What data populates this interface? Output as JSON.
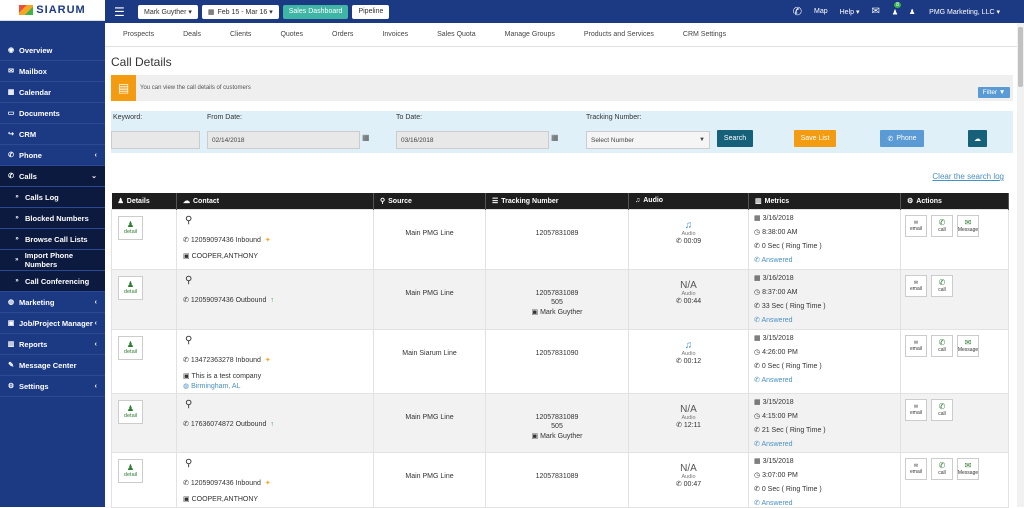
{
  "logo": {
    "text": "SIARUM"
  },
  "sidebar": {
    "items": [
      {
        "label": "Overview",
        "icon": "dashboard-icon",
        "glyph": "◉",
        "chev": ""
      },
      {
        "label": "Mailbox",
        "icon": "envelope-icon",
        "glyph": "✉",
        "chev": ""
      },
      {
        "label": "Calendar",
        "icon": "calendar-icon",
        "glyph": "▦",
        "chev": ""
      },
      {
        "label": "Documents",
        "icon": "folder-icon",
        "glyph": "▭",
        "chev": ""
      },
      {
        "label": "CRM",
        "icon": "share-icon",
        "glyph": "↪",
        "chev": ""
      },
      {
        "label": "Phone",
        "icon": "phone-icon",
        "glyph": "✆",
        "chev": "‹"
      },
      {
        "label": "Calls",
        "icon": "phone-icon",
        "glyph": "✆",
        "chev": "⌄"
      },
      {
        "label": "Calls Log",
        "icon": "chevron-right-icon",
        "glyph": "»",
        "chev": ""
      },
      {
        "label": "Blocked Numbers",
        "icon": "chevron-right-icon",
        "glyph": "»",
        "chev": ""
      },
      {
        "label": "Browse Call Lists",
        "icon": "chevron-right-icon",
        "glyph": "»",
        "chev": ""
      },
      {
        "label": "Import Phone Numbers",
        "icon": "chevron-right-icon",
        "glyph": "»",
        "chev": ""
      },
      {
        "label": "Call Conferencing",
        "icon": "chevron-right-icon",
        "glyph": "»",
        "chev": ""
      },
      {
        "label": "Marketing",
        "icon": "globe-icon",
        "glyph": "◍",
        "chev": "‹"
      },
      {
        "label": "Job/Project Manager",
        "icon": "briefcase-icon",
        "glyph": "▣",
        "chev": "‹"
      },
      {
        "label": "Reports",
        "icon": "chart-icon",
        "glyph": "▥",
        "chev": "‹"
      },
      {
        "label": "Message Center",
        "icon": "edit-icon",
        "glyph": "✎",
        "chev": ""
      },
      {
        "label": "Settings",
        "icon": "gear-icon",
        "glyph": "⚙",
        "chev": "‹"
      }
    ]
  },
  "topbar": {
    "user_select": "Mark Guyther ▾",
    "date_range": "Feb 15 - Mar 16 ▾",
    "sales_dashboard": "Sales Dashboard",
    "pipeline": "Pipeline",
    "map": "Map",
    "help": "Help ▾",
    "notif_count": "8",
    "company": "PMG Marketing, LLC ▾"
  },
  "menu": [
    "Prospects",
    "Deals",
    "Clients",
    "Quotes",
    "Orders",
    "Invoices",
    "Sales Quota",
    "Manage Groups",
    "Products and Services",
    "CRM Settings"
  ],
  "page": {
    "title": "Call Details",
    "info": "You can view the call details of customers",
    "filter_btn": "Filter ▼",
    "clear": "Clear the search log"
  },
  "filters": {
    "keyword_label": "Keyword:",
    "keyword_value": "",
    "from_label": "From Date:",
    "from_value": "02/14/2018",
    "to_label": "To Date:",
    "to_value": "03/16/2018",
    "tracking_label": "Tracking Number:",
    "tracking_value": "Select Number",
    "search": "Search",
    "save_list": "Save List",
    "phone": "Phone",
    "cloud_glyph": "☁"
  },
  "colors": {
    "sidebar": "#1c3a84",
    "teal": "#3fb5a6",
    "orange": "#f39c12",
    "blue": "#5b9bd5",
    "dark_teal": "#16607a"
  },
  "table": {
    "headers": [
      "Details",
      "Contact",
      "Source",
      "Tracking Number",
      "Audio",
      "Metrics",
      "Actions"
    ],
    "header_icons": [
      "person-icon",
      "cloud-icon",
      "search-icon",
      "list-icon",
      "headphones-icon",
      "chart-icon",
      "gear-icon"
    ],
    "header_glyphs": [
      "♟",
      "☁",
      "⚲",
      "☰",
      "♫",
      "▥",
      "⚙"
    ],
    "detail_label": "detail",
    "audio_label": "Audio",
    "rows": [
      {
        "phone": "12059097436",
        "dir": "Inbound",
        "line2": "COOPER,ANTHONY",
        "line3": "",
        "source": "Main PMG Line",
        "tracking": "12057831089",
        "ext": "",
        "agent": "",
        "audio": "play",
        "na": "",
        "duration": "00:09",
        "date": "3/16/2018",
        "time": "8:38:00 AM",
        "ring": "0 Sec ( Ring Time )",
        "status": "Answered",
        "actions": [
          "email",
          "call",
          "Message"
        ]
      },
      {
        "phone": "12059097436",
        "dir": "Outbound",
        "line2": "",
        "line3": "",
        "source": "Main PMG Line",
        "tracking": "12057831089",
        "ext": "505",
        "agent": "Mark Guyther",
        "audio": "na",
        "na": "N/A",
        "duration": "00:44",
        "date": "3/16/2018",
        "time": "8:37:00 AM",
        "ring": "33 Sec ( Ring Time )",
        "status": "Answered",
        "actions": [
          "email",
          "call"
        ]
      },
      {
        "phone": "13472363278",
        "dir": "Inbound",
        "line2": "This is a test company",
        "line3": "Birmingham, AL",
        "source": "Main Siarum Line",
        "tracking": "12057831090",
        "ext": "",
        "agent": "",
        "audio": "play",
        "na": "",
        "duration": "00:12",
        "date": "3/15/2018",
        "time": "4:26:00 PM",
        "ring": "0 Sec ( Ring Time )",
        "status": "Answered",
        "actions": [
          "email",
          "call",
          "Message"
        ]
      },
      {
        "phone": "17636074872",
        "dir": "Outbound",
        "line2": "",
        "line3": "",
        "source": "Main PMG Line",
        "tracking": "12057831089",
        "ext": "505",
        "agent": "Mark Guyther",
        "audio": "na",
        "na": "N/A",
        "duration": "12:11",
        "date": "3/15/2018",
        "time": "4:15:00 PM",
        "ring": "21 Sec ( Ring Time )",
        "status": "Answered",
        "actions": [
          "email",
          "call"
        ]
      },
      {
        "phone": "12059097436",
        "dir": "Inbound",
        "line2": "COOPER,ANTHONY",
        "line3": "",
        "source": "Main PMG Line",
        "tracking": "12057831089",
        "ext": "",
        "agent": "",
        "audio": "na",
        "na": "N/A",
        "duration": "00:47",
        "date": "3/15/2018",
        "time": "3:07:00 PM",
        "ring": "0 Sec ( Ring Time )",
        "status": "Answered",
        "actions": [
          "email",
          "call",
          "Message"
        ]
      }
    ]
  }
}
